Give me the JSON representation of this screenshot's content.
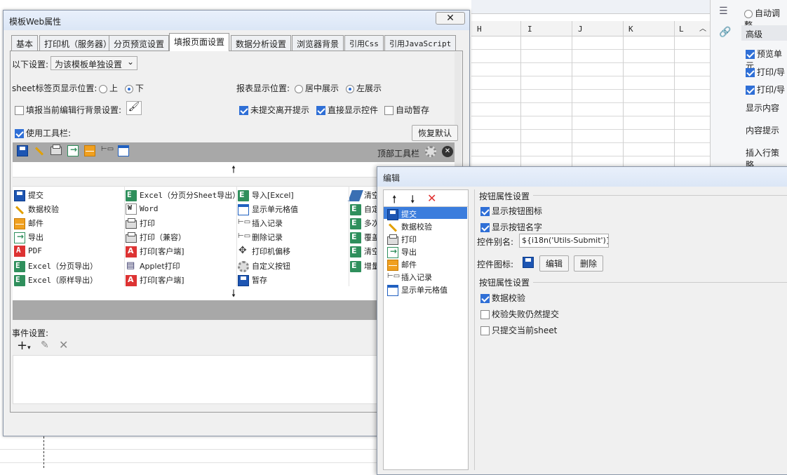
{
  "spreadsheet": {
    "columns": [
      "H",
      "I",
      "J",
      "K",
      "L"
    ]
  },
  "right_panel": {
    "radio_label": "自动调整",
    "section_title": "高级",
    "checks": [
      "预览单元",
      "打印/导",
      "打印/导"
    ],
    "labels": [
      "显示内容",
      "内容提示",
      "插入行策略"
    ]
  },
  "main_dialog": {
    "title": "模板Web属性",
    "tabs": [
      "基本",
      "打印机（服务器）",
      "分页预览设置",
      "填报页面设置",
      "数据分析设置",
      "浏览器背景",
      "引用Css",
      "引用JavaScript"
    ],
    "active_tab": "填报页面设置",
    "settings_label": "以下设置:",
    "settings_value": "为该模板单独设置",
    "sheet_pos_label": "sheet标签页显示位置:",
    "sheet_pos_opts": [
      "上",
      "下"
    ],
    "report_pos_label": "报表显示位置:",
    "report_pos_opts": [
      "居中展示",
      "左展示"
    ],
    "bg_label": "填报当前编辑行背景设置:",
    "unsubmitted_label": "未提交离开提示",
    "direct_ctrl_label": "直接显示控件",
    "autosave_label": "自动暂存",
    "use_toolbar_label": "使用工具栏:",
    "restore_btn": "恢复默认",
    "top_toolbar_label": "顶部工具栏",
    "buttons_col1": [
      "提交",
      "数据校验",
      "邮件",
      "导出",
      "PDF",
      "Excel（分页导出）",
      "Excel（原样导出）"
    ],
    "buttons_col2": [
      "Excel（分页分Sheet导出）",
      "Word",
      "打印",
      "打印（兼容）",
      "打印[客户端]",
      "Applet打印",
      "打印[客户端]"
    ],
    "buttons_col3": [
      "导入[Excel]",
      "显示单元格值",
      "插入记录",
      "删除记录",
      "打印机偏移",
      "自定义按钮",
      "暂存"
    ],
    "buttons_col4": [
      "清空",
      "自定",
      "多次",
      "覆盖",
      "清空",
      "增量"
    ],
    "event_label": "事件设置:"
  },
  "edit_dialog": {
    "title": "编辑",
    "items": [
      "提交",
      "数据校验",
      "打印",
      "导出",
      "邮件",
      "插入记录",
      "显示单元格值"
    ],
    "selected": "提交",
    "section1": "按钮属性设置",
    "show_icon": "显示按钮图标",
    "show_name": "显示按钮名字",
    "alias_label": "控件别名:",
    "alias_value": "${i18n('Utils-Submit')}",
    "icon_label": "控件图标:",
    "edit_btn": "编辑",
    "delete_btn": "删除",
    "section2": "按钮属性设置",
    "check_validate": "数据校验",
    "check_fail_submit": "校验失败仍然提交",
    "check_current_sheet": "只提交当前sheet"
  }
}
